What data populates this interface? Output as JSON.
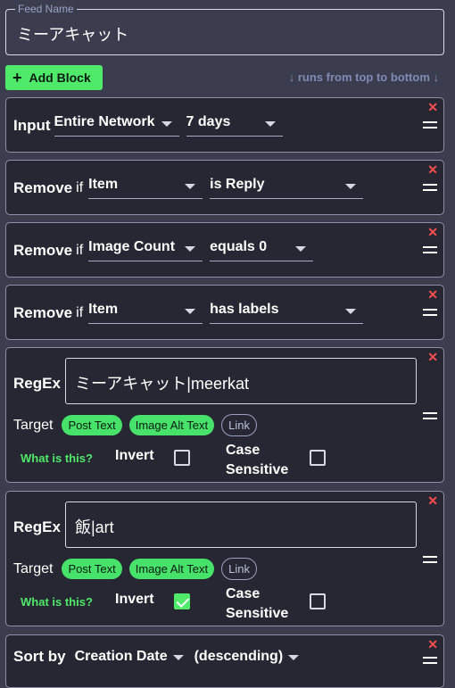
{
  "feed": {
    "label": "Feed Name",
    "value": "ミーアキャット"
  },
  "toolbar": {
    "add_label": "Add Block",
    "add_icon": "plus-icon",
    "hint": "↓ runs from top to bottom ↓"
  },
  "blocks": {
    "input": {
      "title": "Input",
      "source": "Entire Network",
      "range": "7 days"
    },
    "remove1": {
      "title": "Remove",
      "if": "if",
      "field": "Item",
      "cond": "is Reply"
    },
    "remove2": {
      "title": "Remove",
      "if": "if",
      "field": "Image Count",
      "cond": "equals 0"
    },
    "remove3": {
      "title": "Remove",
      "if": "if",
      "field": "Item",
      "cond": "has labels"
    },
    "regex1": {
      "title": "RegEx",
      "pattern": "ミーアキャット|meerkat",
      "target_label": "Target",
      "targets": [
        "Post Text",
        "Image Alt Text",
        "Link"
      ],
      "what": "What is this?",
      "invert": "Invert",
      "case_line1": "Case",
      "case_line2": "Sensitive",
      "invert_checked": false,
      "case_checked": false
    },
    "regex2": {
      "title": "RegEx",
      "pattern": "飯|art",
      "target_label": "Target",
      "targets": [
        "Post Text",
        "Image Alt Text",
        "Link"
      ],
      "what": "What is this?",
      "invert": "Invert",
      "case_line1": "Case",
      "case_line2": "Sensitive",
      "invert_checked": true,
      "case_checked": false
    },
    "sort": {
      "title": "Sort by",
      "field": "Creation Date",
      "order": "(descending)"
    }
  },
  "colors": {
    "accent": "#4fea69",
    "close": "#ff4e4e",
    "hint": "#7f8ab5"
  }
}
